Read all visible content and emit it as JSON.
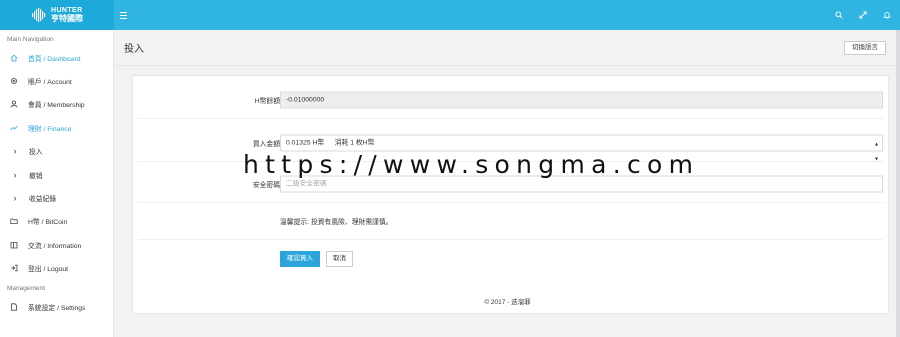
{
  "header": {
    "brand_line1": "HUNTER",
    "brand_line2": "亨特國際"
  },
  "sidebar": {
    "section_main": "Main Navigation",
    "items": [
      {
        "label": "首頁 / Dashboard",
        "icon": "home-icon"
      },
      {
        "label": "賬戶 / Account",
        "icon": "gear-icon"
      },
      {
        "label": "會員 / Membership",
        "icon": "user-icon"
      },
      {
        "label": "理財 / Finance",
        "icon": "trend-icon"
      },
      {
        "label": "投入",
        "icon": "chevron-right-icon"
      },
      {
        "label": "撤销",
        "icon": "chevron-right-icon"
      },
      {
        "label": "收益紀錄",
        "icon": "chevron-right-icon"
      },
      {
        "label": "H幣 / BitCoin",
        "icon": "folder-icon"
      },
      {
        "label": "交流 / Information",
        "icon": "book-icon"
      },
      {
        "label": "登出 / Logout",
        "icon": "logout-icon"
      }
    ],
    "section_management": "Management",
    "management_items": [
      {
        "label": "系統設定 / Settings",
        "icon": "file-icon"
      }
    ]
  },
  "page": {
    "title": "投入",
    "lang_button": "切換語言"
  },
  "form": {
    "balance_label": "H幣餘額",
    "balance_value": "-0.01000000",
    "amount_label": "買入金額",
    "amount_selected": "0.01325 H幣 　 消耗 1 枚H幣",
    "password_label": "安全密碼",
    "password_placeholder": "二級安全密碼",
    "hint": "溫馨提示: 投資有風險、理財需謹慎。",
    "confirm_button": "確認買入",
    "cancel_button": "取消"
  },
  "footer": {
    "text": "© 2017 - 迭溜罪"
  },
  "watermark": {
    "text": "https://www.songma.com"
  },
  "colors": {
    "topbar": "#30b5e2",
    "accent": "#2aa6dd"
  }
}
